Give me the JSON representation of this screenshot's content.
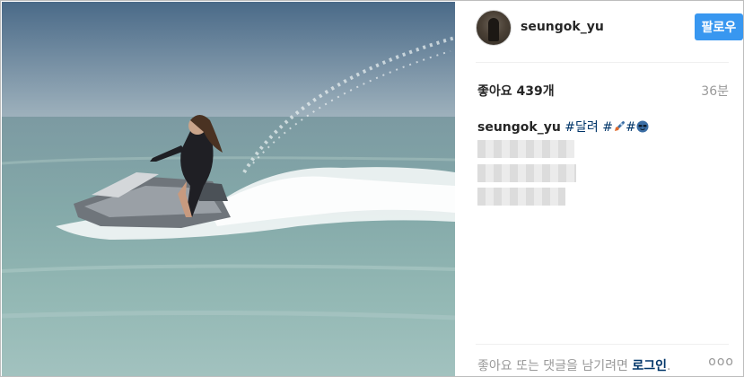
{
  "post": {
    "username": "seungok_yu",
    "follow_label": "팔로우",
    "likes_text": "좋아요 439개",
    "time_ago": "36분",
    "caption_username": "seungok_yu",
    "caption_hashtag": "#달려",
    "caption_hash2": "#",
    "caption_hash3": "#",
    "footer_text": "좋아요 또는 댓글을 남기려면",
    "footer_login": "로그인",
    "footer_period": ".",
    "more_label": "ooo"
  },
  "icons": {
    "rocket": "rocket-icon",
    "sunglasses": "sunglasses-face-icon"
  },
  "colors": {
    "follow_button": "#3897f0",
    "link": "#003569",
    "muted": "#999999"
  }
}
